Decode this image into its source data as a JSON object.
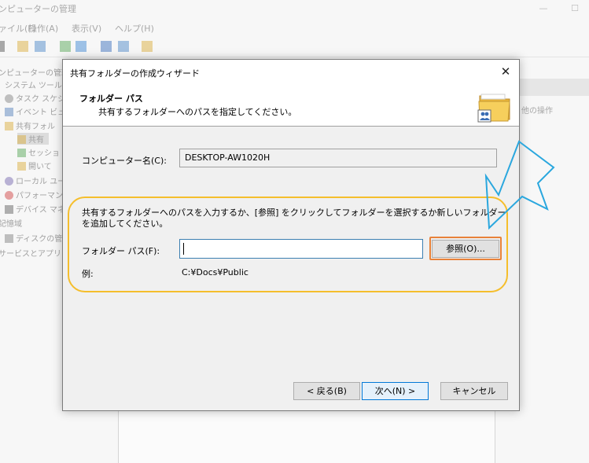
{
  "background": {
    "window_title": "ンピューターの管理",
    "menu": [
      "ァイル(F)",
      "操作(A)",
      "表示(V)",
      "ヘルプ(H)"
    ],
    "tree": [
      "ンピューターの管理",
      "システム ツール",
      "タスク スケジ",
      "イベント ビュ",
      "共有フォル",
      "共有",
      "セッショ",
      "開いて",
      "ローカル ユー",
      "パフォーマン",
      "デバイス マネ",
      "記憶域",
      "ディスクの管",
      "サービスとアプリ"
    ],
    "right_pane_item": "他の操作"
  },
  "dialog": {
    "title": "共有フォルダーの作成ウィザード",
    "header_title": "フォルダー パス",
    "header_subtitle": "共有するフォルダーへのパスを指定してください。",
    "computer_name_label": "コンピューター名(C):",
    "computer_name_value": "DESKTOP-AW1020H",
    "instruction": "共有するフォルダーへのパスを入力するか、[参照] をクリックしてフォルダーを選択するか新しいフォルダーを追加してください。",
    "folder_path_label": "フォルダー パス(F):",
    "folder_path_value": "",
    "browse_button": "参照(O)...",
    "example_label": "例:",
    "example_value": "C:¥Docs¥Public",
    "back_button": "< 戻る(B)",
    "next_button": "次へ(N) >",
    "cancel_button": "キャンセル"
  },
  "colors": {
    "highlight_yellow": "#f5be2c",
    "highlight_orange": "#e8823a",
    "arrow_blue": "#2aa7de",
    "focus_blue": "#0078d7"
  },
  "icons": [
    "folder-share-icon",
    "close-icon",
    "arrow-annotation-icon"
  ]
}
